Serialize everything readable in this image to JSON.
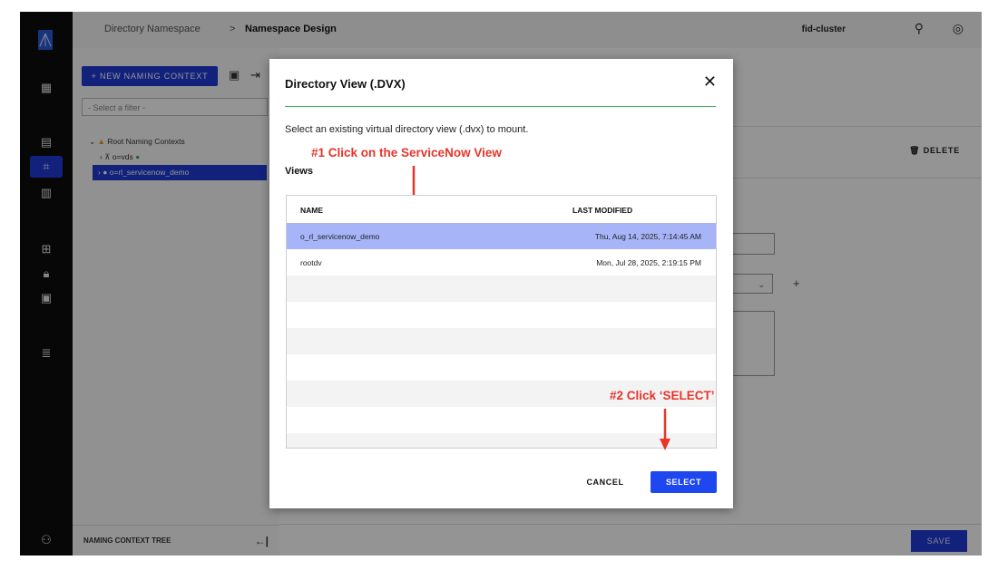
{
  "topbar": {
    "breadcrumb_root": "Directory Namespace",
    "breadcrumb_sep": ">",
    "breadcrumb_current": "Namespace Design",
    "cluster": "fid-cluster",
    "search_icon": "⚲",
    "account_icon": "◎"
  },
  "rail": {
    "icons": [
      "dashboard-icon",
      "directory-browser-icon",
      "namespace-icon",
      "report-icon",
      "grid-icon",
      "lock-icon",
      "file-check-icon",
      "list-icon",
      "user-settings-icon"
    ]
  },
  "left_panel": {
    "new_naming_context": "+ NEW NAMING CONTEXT",
    "filter_placeholder": "- Select a filter -",
    "tree": {
      "root": "Root Naming Contexts",
      "node_vds": "o=vds",
      "node_selected": "o=rl_servicenow_demo"
    },
    "footer_label": "NAMING CONTEXT TREE"
  },
  "right_panel": {
    "delete_label": "DELETE",
    "save_label": "SAVE"
  },
  "modal": {
    "title": "Directory View (.DVX)",
    "close_symbol": "✕",
    "description": "Select an existing virtual directory view (.dvx) to mount.",
    "views_label": "Views",
    "columns": {
      "name": "NAME",
      "last_modified": "LAST MODIFIED"
    },
    "rows": [
      {
        "name": "o_rl_servicenow_demo",
        "modified": "Thu, Aug 14, 2025, 7:14:45 AM"
      },
      {
        "name": "rootdv",
        "modified": "Mon, Jul 28, 2025, 2:19:15 PM"
      }
    ],
    "cancel_label": "CANCEL",
    "select_label": "SELECT"
  },
  "annotations": {
    "step1": "#1 Click on the ServiceNow View",
    "step2": "#2 Click ‘SELECT’",
    "color": "#e8342a"
  },
  "colors": {
    "accent": "#1f3bd6",
    "selected_row": "#a7b4f7",
    "divider": "#3fae5b"
  }
}
